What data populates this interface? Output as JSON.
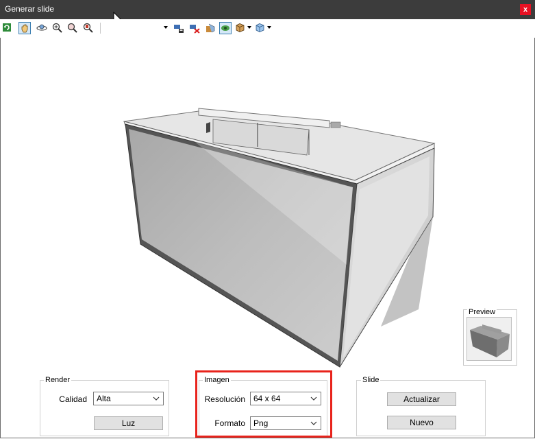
{
  "window": {
    "title": "Generar slide",
    "close_glyph": "x"
  },
  "toolbar": {
    "icons": [
      "refresh-icon",
      "hand-pan-icon",
      "orbit-icon",
      "zoom-icon",
      "zoom-in-icon",
      "zoom-out-icon",
      "camera-save-icon",
      "camera-delete-icon",
      "furniture-icon",
      "eye-icon",
      "cube-icon",
      "view-cube-icon"
    ],
    "selected": [
      "hand-pan-icon",
      "eye-icon"
    ]
  },
  "preview": {
    "label": "Preview"
  },
  "render": {
    "label": "Render",
    "calidad_label": "Calidad",
    "calidad_value": "Alta",
    "luz_label": "Luz"
  },
  "imagen": {
    "label": "Imagen",
    "resolucion_label": "Resolución",
    "resolucion_value": "64 x 64",
    "formato_label": "Formato",
    "formato_value": "Png"
  },
  "slide": {
    "label": "Slide",
    "actualizar_label": "Actualizar",
    "nuevo_label": "Nuevo"
  },
  "colors": {
    "titlebar": "#3c3c3c",
    "close": "#e81123",
    "highlight": "#e8231c",
    "selected": "#3c7fb1"
  }
}
